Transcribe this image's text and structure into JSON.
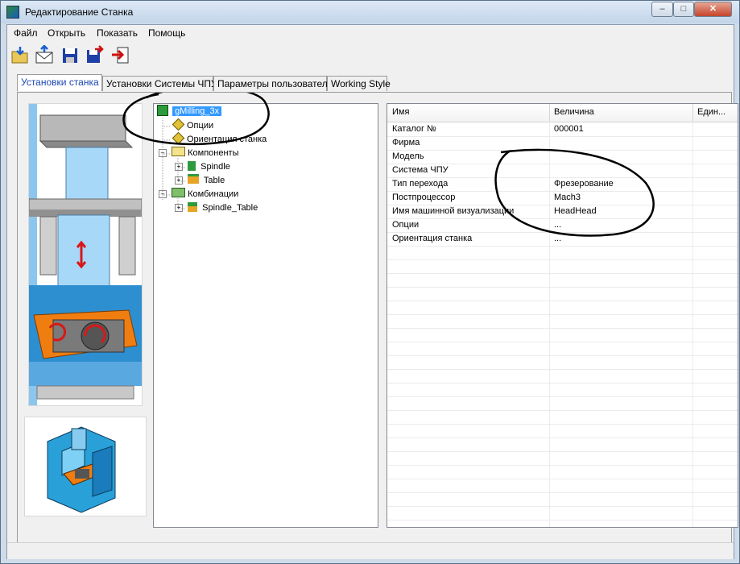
{
  "window": {
    "title": "Редактирование Станка",
    "controls": [
      "minimize",
      "maximize",
      "close"
    ]
  },
  "menu": {
    "items": [
      "Файл",
      "Открыть",
      "Показать",
      "Помощь"
    ]
  },
  "toolbar": {
    "buttons": [
      "open-icon",
      "mail-icon",
      "save-icon",
      "save-as-icon",
      "exit-icon"
    ]
  },
  "tabs": [
    {
      "label": "Установки станка",
      "active": true
    },
    {
      "label": "Установки Системы ЧПУ",
      "active": false
    },
    {
      "label": "Параметры пользователя",
      "active": false
    },
    {
      "label": "Working Style",
      "active": false
    }
  ],
  "tree": {
    "root": "gMilling_3x",
    "items": [
      {
        "label": "Опции"
      },
      {
        "label": "Ориентация станка"
      },
      {
        "label": "Компоненты"
      },
      {
        "label": "Spindle"
      },
      {
        "label": "Table"
      },
      {
        "label": "Комбинации"
      },
      {
        "label": "Spindle_Table"
      }
    ]
  },
  "grid": {
    "headers": [
      "Имя",
      "Величина",
      "Един..."
    ],
    "rows": [
      {
        "name": "Каталог №",
        "value": "000001"
      },
      {
        "name": "Фирма",
        "value": ""
      },
      {
        "name": "Модель",
        "value": ""
      },
      {
        "name": "Система ЧПУ",
        "value": ""
      },
      {
        "name": "Тип перехода",
        "value": "Фрезерование"
      },
      {
        "name": "Постпроцессор",
        "value": "Mach3"
      },
      {
        "name": "Имя машинной визуализации",
        "value": "HeadHead"
      },
      {
        "name": "Опции",
        "value": "..."
      },
      {
        "name": "Ориентация станка",
        "value": "..."
      }
    ]
  },
  "colors": {
    "accent": "#1a45b5",
    "selection": "#3399ff",
    "machine_orange": "#f07d10",
    "machine_blue": "#7ec4f0"
  }
}
